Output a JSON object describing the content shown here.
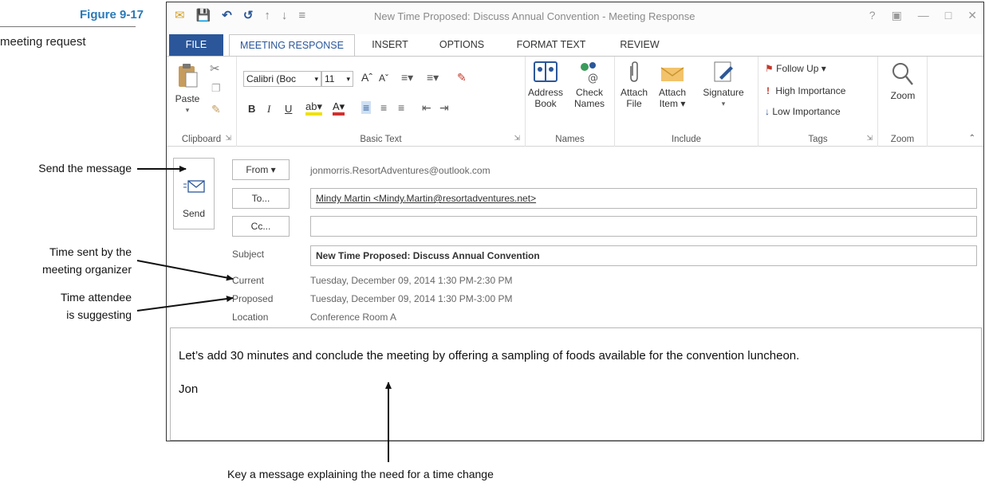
{
  "figure": {
    "number": "Figure 9-17",
    "subtitle": "meeting request"
  },
  "callouts": {
    "send": "Send the message",
    "time_sent_line1": "Time sent by the",
    "time_sent_line2": "meeting organizer",
    "time_attendee_line1": "Time attendee",
    "time_attendee_line2": "is suggesting",
    "key_message": "Key a message explaining the need for a time change"
  },
  "window": {
    "title": "New Time Proposed: Discuss Annual Convention - Meeting Response",
    "controls": [
      "?",
      "▣",
      "—",
      "□",
      "✕"
    ]
  },
  "qat": {
    "mail_icon": "mail-icon",
    "save_icon": "save-icon",
    "undo_icon": "undo-icon",
    "redo_icon": "redo-icon"
  },
  "tabs": [
    "FILE",
    "MEETING RESPONSE",
    "INSERT",
    "OPTIONS",
    "FORMAT TEXT",
    "REVIEW"
  ],
  "ribbon": {
    "clipboard": {
      "paste": "Paste",
      "label": "Clipboard"
    },
    "basic_text": {
      "font_name": "Calibri (Boc",
      "font_size": "11",
      "label": "Basic Text",
      "bold": "B",
      "italic": "I",
      "underline": "U"
    },
    "names": {
      "address_book_1": "Address",
      "address_book_2": "Book",
      "check_names_1": "Check",
      "check_names_2": "Names",
      "label": "Names"
    },
    "include": {
      "attach_file_1": "Attach",
      "attach_file_2": "File",
      "attach_item_1": "Attach",
      "attach_item_2": "Item ▾",
      "signature": "Signature",
      "label": "Include"
    },
    "tags": {
      "follow_up": "Follow Up ▾",
      "high": "High Importance",
      "low": "Low Importance",
      "label": "Tags"
    },
    "zoom": {
      "zoom": "Zoom",
      "label": "Zoom"
    }
  },
  "form": {
    "send_label": "Send",
    "from_label": "From ▾",
    "from_value": "jonmorris.ResortAdventures@outlook.com",
    "to_label": "To...",
    "to_value": "Mindy Martin <Mindy.Martin@resortadventures.net>",
    "cc_label": "Cc...",
    "cc_value": "",
    "subject_label": "Subject",
    "subject_value": "New Time Proposed: Discuss Annual Convention",
    "current_label": "Current",
    "current_value": "Tuesday, December 09, 2014 1:30 PM-2:30 PM",
    "proposed_label": "Proposed",
    "proposed_value": "Tuesday, December 09, 2014 1:30 PM-3:00 PM",
    "location_label": "Location",
    "location_value": "Conference Room A"
  },
  "message": {
    "body": "Let’s add 30 minutes and conclude the meeting by offering a sampling of foods available for the convention luncheon.",
    "signature": "Jon"
  },
  "colors": {
    "accent": "#2b579a",
    "figure_title": "#2a7ab8"
  }
}
